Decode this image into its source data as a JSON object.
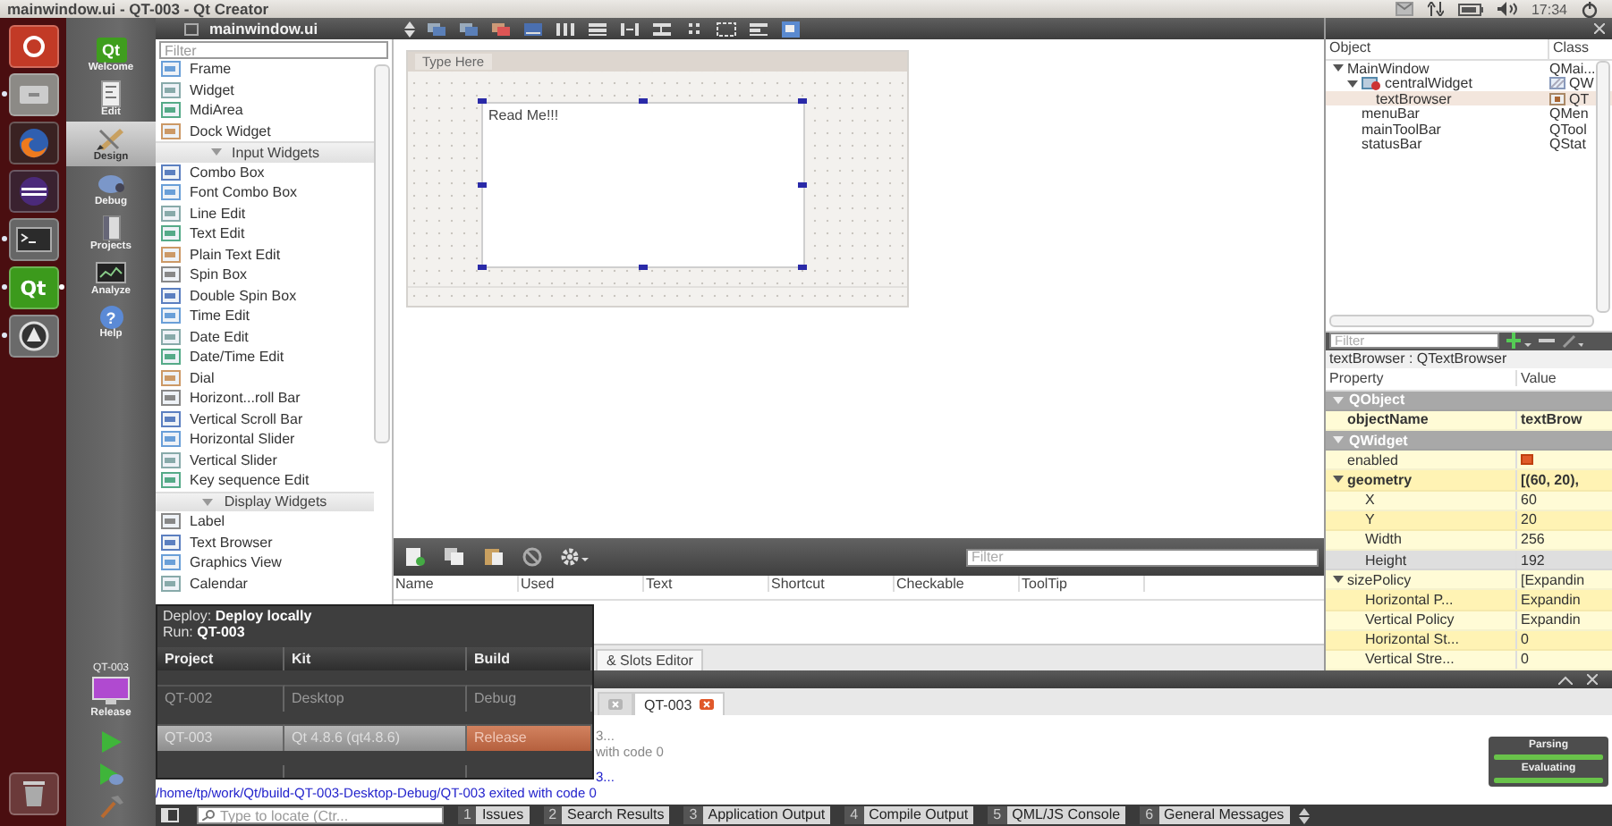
{
  "title_bar": {
    "title": "mainwindow.ui - QT-003 - Qt Creator",
    "clock": "17:34"
  },
  "launcher": [
    {
      "kind": "ubuntu",
      "running": false,
      "focused": false
    },
    {
      "kind": "files",
      "running": true,
      "focused": false
    },
    {
      "kind": "firefox",
      "running": false,
      "focused": false
    },
    {
      "kind": "eclipse",
      "running": false,
      "focused": false
    },
    {
      "kind": "terminal",
      "running": true,
      "focused": false
    },
    {
      "kind": "qt",
      "logo": "Qt",
      "running": true,
      "focused": true
    },
    {
      "kind": "updater",
      "running": true,
      "focused": false
    },
    {
      "kind": "trash",
      "running": false,
      "focused": false
    }
  ],
  "mode_bar": {
    "modes": [
      {
        "kind": "welcome",
        "label": "Welcome",
        "logo": "Qt",
        "selected": false
      },
      {
        "kind": "edit",
        "label": "Edit",
        "selected": false
      },
      {
        "kind": "design",
        "label": "Design",
        "selected": true
      },
      {
        "kind": "debug",
        "label": "Debug",
        "selected": false
      },
      {
        "kind": "projects",
        "label": "Projects",
        "selected": false
      },
      {
        "kind": "analyze",
        "label": "Analyze",
        "selected": false
      },
      {
        "kind": "help",
        "label": "Help",
        "glyph": "?",
        "selected": false
      }
    ],
    "target": {
      "project": "QT-003",
      "build": "Release"
    }
  },
  "document": {
    "title": "mainwindow.ui"
  },
  "widget_box": {
    "filter_placeholder": "Filter",
    "items": [
      {
        "kind": "widget",
        "label": "Frame"
      },
      {
        "kind": "widget",
        "label": "Widget"
      },
      {
        "kind": "widget",
        "label": "MdiArea"
      },
      {
        "kind": "widget",
        "label": "Dock Widget"
      },
      {
        "kind": "group",
        "label": "Input Widgets"
      },
      {
        "kind": "widget",
        "label": "Combo Box"
      },
      {
        "kind": "widget",
        "label": "Font Combo Box"
      },
      {
        "kind": "widget",
        "label": "Line Edit"
      },
      {
        "kind": "widget",
        "label": "Text Edit"
      },
      {
        "kind": "widget",
        "label": "Plain Text Edit"
      },
      {
        "kind": "widget",
        "label": "Spin Box"
      },
      {
        "kind": "widget",
        "label": "Double Spin Box"
      },
      {
        "kind": "widget",
        "label": "Time Edit"
      },
      {
        "kind": "widget",
        "label": "Date Edit"
      },
      {
        "kind": "widget",
        "label": "Date/Time Edit"
      },
      {
        "kind": "widget",
        "label": "Dial"
      },
      {
        "kind": "widget",
        "label": "Horizont...roll Bar"
      },
      {
        "kind": "widget",
        "label": "Vertical Scroll Bar"
      },
      {
        "kind": "widget",
        "label": "Horizontal Slider"
      },
      {
        "kind": "widget",
        "label": "Vertical Slider"
      },
      {
        "kind": "widget",
        "label": "Key sequence Edit"
      },
      {
        "kind": "group",
        "label": "Display Widgets"
      },
      {
        "kind": "widget",
        "label": "Label"
      },
      {
        "kind": "widget",
        "label": "Text Browser"
      },
      {
        "kind": "widget",
        "label": "Graphics View"
      },
      {
        "kind": "widget",
        "label": "Calendar"
      }
    ]
  },
  "form": {
    "menu_placeholder": "Type Here",
    "text_browser": "Read Me!!!"
  },
  "action_editor": {
    "filter_placeholder": "Filter",
    "columns": [
      "Name",
      "Used",
      "Text",
      "Shortcut",
      "Checkable",
      "ToolTip"
    ],
    "tab": "& Slots Editor"
  },
  "object_inspector": {
    "columns": [
      "Object",
      "Class"
    ],
    "tree": [
      {
        "kind": "plain",
        "name": "MainWindow",
        "class": "QMai...",
        "expanded": true,
        "selected": false,
        "children": [
          {
            "kind": "container",
            "name": "centralWidget",
            "class": "QW",
            "expanded": true,
            "selected": false,
            "children": [
              {
                "kind": "widget",
                "name": "textBrowser",
                "class": "QT",
                "selected": true
              }
            ]
          },
          {
            "kind": "plain",
            "name": "menuBar",
            "class": "QMen",
            "selected": false
          },
          {
            "kind": "plain",
            "name": "mainToolBar",
            "class": "QTool",
            "selected": false
          },
          {
            "kind": "plain",
            "name": "statusBar",
            "class": "QStat",
            "selected": false
          }
        ]
      }
    ],
    "filter_placeholder": "Filter",
    "selection_label": "textBrowser : QTextBrowser"
  },
  "property_editor": {
    "columns": [
      "Property",
      "Value"
    ],
    "rows": [
      {
        "kind": "group",
        "name": "QObject"
      },
      {
        "kind": "text",
        "name": "objectName",
        "value": "textBrow",
        "modified": true,
        "selected": false
      },
      {
        "kind": "group",
        "name": "QWidget"
      },
      {
        "kind": "checkbox",
        "name": "enabled",
        "checked": true,
        "modified": false,
        "selected": false
      },
      {
        "kind": "text",
        "name": "geometry",
        "value": "[(60, 20),",
        "modified": true,
        "selected": false,
        "expanded": true,
        "children": [
          {
            "kind": "text",
            "name": "X",
            "value": "60",
            "modified": false,
            "selected": false
          },
          {
            "kind": "text",
            "name": "Y",
            "value": "20",
            "modified": false,
            "selected": false
          },
          {
            "kind": "text",
            "name": "Width",
            "value": "256",
            "modified": false,
            "selected": false
          },
          {
            "kind": "text",
            "name": "Height",
            "value": "192",
            "modified": false,
            "selected": true
          }
        ]
      },
      {
        "kind": "text",
        "name": "sizePolicy",
        "value": "[Expandin",
        "modified": false,
        "selected": false,
        "expanded": true,
        "children": [
          {
            "kind": "text",
            "name": "Horizontal P...",
            "value": "Expandin",
            "modified": false,
            "selected": false
          },
          {
            "kind": "text",
            "name": "Vertical Policy",
            "value": "Expandin",
            "modified": false,
            "selected": false
          },
          {
            "kind": "text",
            "name": "Horizontal St...",
            "value": "0",
            "modified": false,
            "selected": false
          },
          {
            "kind": "text",
            "name": "Vertical Stre...",
            "value": "0",
            "modified": false,
            "selected": false
          }
        ]
      }
    ]
  },
  "output": {
    "tabs": [
      {
        "selected": false
      },
      {
        "label": "QT-003",
        "selected": true
      }
    ],
    "lines": [
      {
        "kind": "note",
        "covered": true,
        "text": "3..."
      },
      {
        "kind": "note",
        "covered": true,
        "text": "with code 0"
      },
      {
        "kind": "run",
        "covered": true,
        "text": "3..."
      },
      {
        "kind": "run",
        "covered": false,
        "text": "/home/tp/work/Qt/build-QT-003-Desktop-Debug/QT-003 exited with code 0"
      }
    ]
  },
  "progress": [
    {
      "label": "Parsing",
      "level": 1
    },
    {
      "label": "Evaluating",
      "level": 1
    }
  ],
  "status_bar": {
    "locator_placeholder": "Type to locate (Ctr...",
    "panes": [
      {
        "number": "1",
        "label": "Issues"
      },
      {
        "number": "2",
        "label": "Search Results"
      },
      {
        "number": "3",
        "label": "Application Output"
      },
      {
        "number": "4",
        "label": "Compile Output"
      },
      {
        "number": "5",
        "label": "QML/JS Console"
      },
      {
        "number": "6",
        "label": "General Messages"
      }
    ]
  },
  "deploy_popup": {
    "deploy": "Deploy: **Deploy locally**",
    "run": "Run: **QT-003**",
    "columns": [
      "Project",
      "Kit",
      "Build"
    ],
    "rows": [
      {
        "project": "QT-002",
        "kit": "Desktop",
        "build": "Debug",
        "selected": false
      },
      {
        "project": "QT-003",
        "kit": "Qt 4.8.6 (qt4.8.6)",
        "build": "Release",
        "selected": true
      }
    ]
  }
}
